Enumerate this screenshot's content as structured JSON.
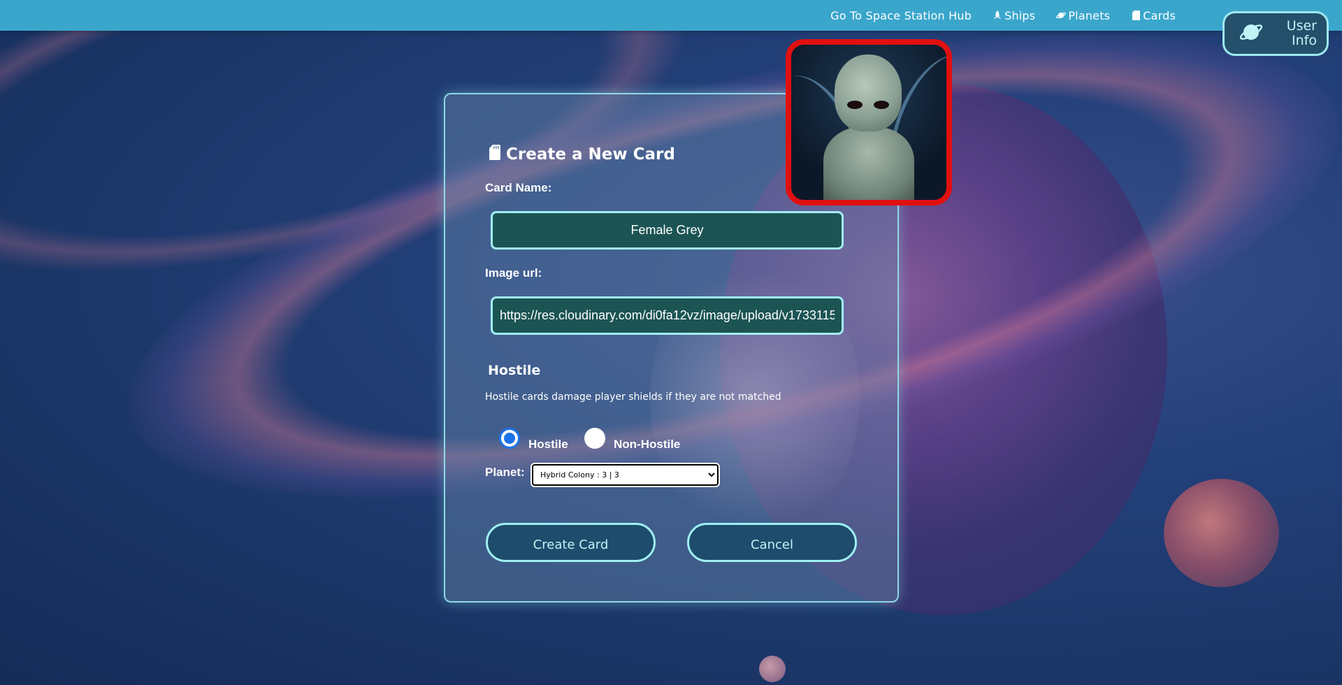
{
  "nav": {
    "links": [
      {
        "label": "Go To Space Station Hub",
        "icon": ""
      },
      {
        "label": "Ships",
        "icon": "rocket-icon"
      },
      {
        "label": "Planets",
        "icon": "planet-icon"
      },
      {
        "label": "Cards",
        "icon": "card-icon"
      }
    ],
    "user_button": {
      "label_line1": "User",
      "label_line2": "Info",
      "icon": "planet-icon"
    }
  },
  "form": {
    "title": "Create a New Card",
    "title_icon": "sd-card-icon",
    "card_name_label": "Card Name:",
    "card_name_value": "Female Grey",
    "image_url_label": "Image url:",
    "image_url_value": "https://res.cloudinary.com/di0fa12vz/image/upload/v1733115",
    "hostile_heading": "Hostile",
    "hostile_hint": "Hostile cards damage player shields if they are not matched",
    "radio_options": [
      {
        "label": "Hostile",
        "checked": true
      },
      {
        "label": "Non-Hostile",
        "checked": false
      }
    ],
    "planet_label": "Planet:",
    "planet_selected": "Hybrid Colony : 3 | 3",
    "create_button": "Create Card",
    "cancel_button": "Cancel"
  },
  "colors": {
    "navbar": "#3aa6cc",
    "accent": "#9ff0f2",
    "preview_border": "#e01010",
    "radio_checked": "#1a73e8"
  }
}
